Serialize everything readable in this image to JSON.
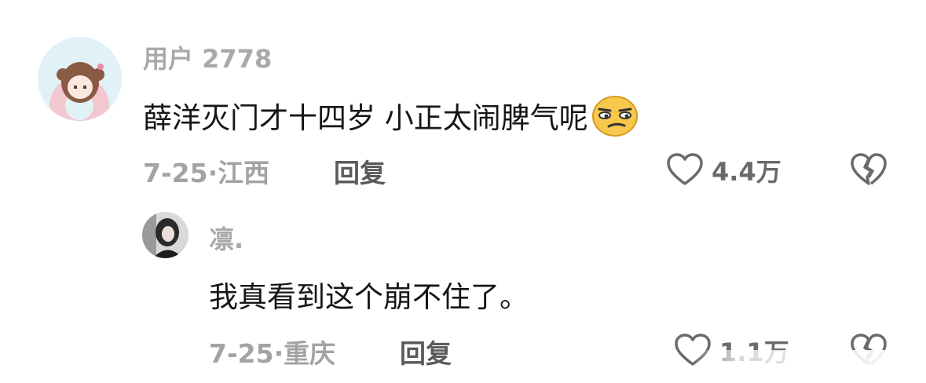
{
  "comments": [
    {
      "username": "用户 2778",
      "text": "薛洋灭门才十四岁 小正太闹脾气呢",
      "emoji": "smirk-emoji",
      "date": "7-25·",
      "location": "江西",
      "reply_label": "回复",
      "likes": "4.4万"
    }
  ],
  "replies": [
    {
      "username": "凛.",
      "text": "我真看到这个崩不住了。",
      "date": "7-25·",
      "location": "重庆",
      "reply_label": "回复",
      "likes": "1.1万"
    }
  ],
  "colors": {
    "username": "#a9a9a9",
    "body_text": "#161616",
    "meta": "#a3a3a3",
    "icon": "#6a6a6a"
  }
}
